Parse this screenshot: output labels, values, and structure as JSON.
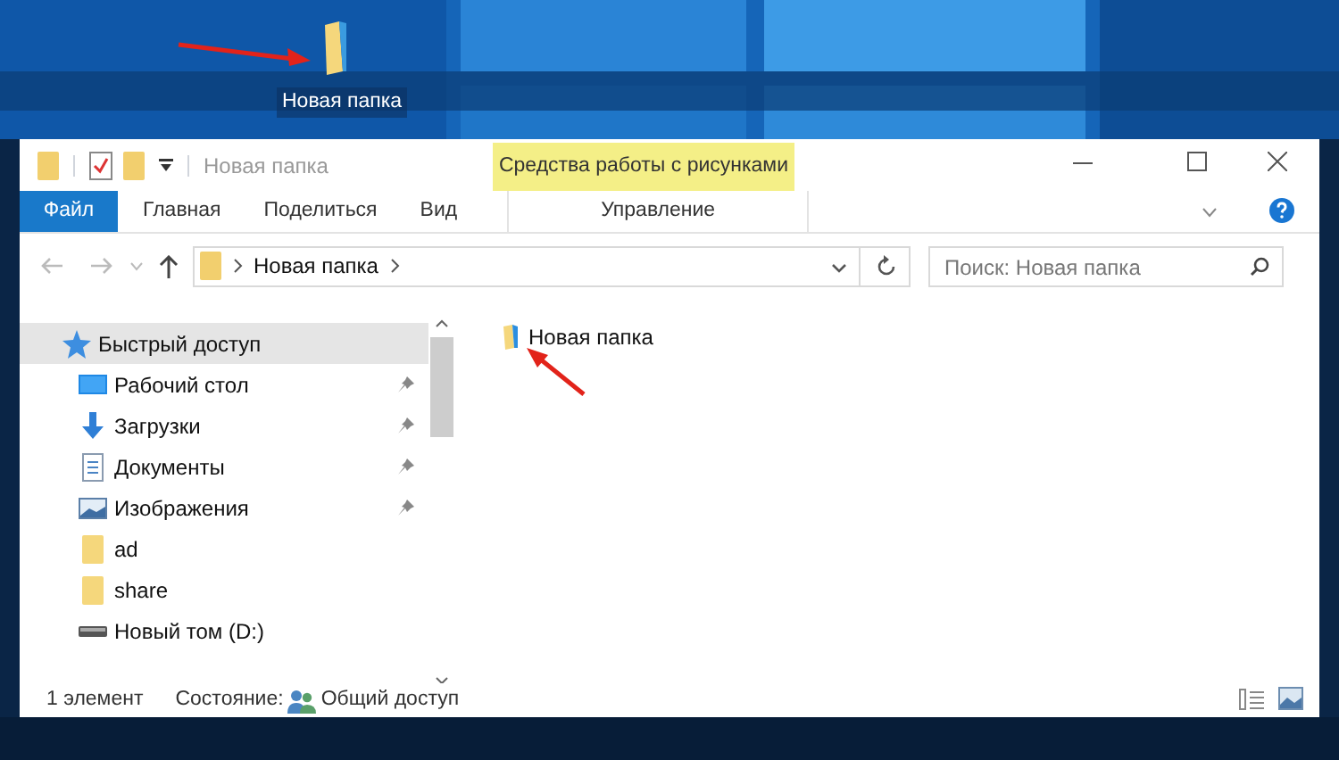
{
  "desktop_icon": {
    "label": "Новая папка"
  },
  "window": {
    "title": "Новая папка"
  },
  "contextual_tab_group": {
    "label": "Средства работы с рисунками"
  },
  "ribbon_tabs": [
    {
      "label": "Файл",
      "kind": "file",
      "selected": false
    },
    {
      "label": "Главная",
      "kind": "tab",
      "selected": false
    },
    {
      "label": "Поделиться",
      "kind": "tab",
      "selected": false
    },
    {
      "label": "Вид",
      "kind": "tab",
      "selected": false
    },
    {
      "label": "Управление",
      "kind": "contextual",
      "selected": false
    }
  ],
  "address_bar": {
    "path": [
      "Новая папка"
    ]
  },
  "search": {
    "placeholder": "Поиск: Новая папка"
  },
  "sidebar": {
    "items": [
      {
        "label": "Быстрый доступ",
        "kind": "star",
        "pinned": false,
        "selected": true
      },
      {
        "label": "Рабочий стол",
        "kind": "desktop",
        "pinned": true,
        "selected": false
      },
      {
        "label": "Загрузки",
        "kind": "download",
        "pinned": true,
        "selected": false
      },
      {
        "label": "Документы",
        "kind": "document",
        "pinned": true,
        "selected": false
      },
      {
        "label": "Изображения",
        "kind": "picture",
        "pinned": true,
        "selected": false
      },
      {
        "label": "ad",
        "kind": "folder",
        "pinned": false,
        "selected": false
      },
      {
        "label": "share",
        "kind": "folder",
        "pinned": false,
        "selected": false
      },
      {
        "label": "Новый том (D:)",
        "kind": "drive",
        "pinned": false,
        "selected": false
      }
    ]
  },
  "files": [
    {
      "name": "Новая папка"
    }
  ],
  "status_bar": {
    "count": "1 элемент",
    "state_label": "Состояние:",
    "state": "Общий доступ"
  }
}
